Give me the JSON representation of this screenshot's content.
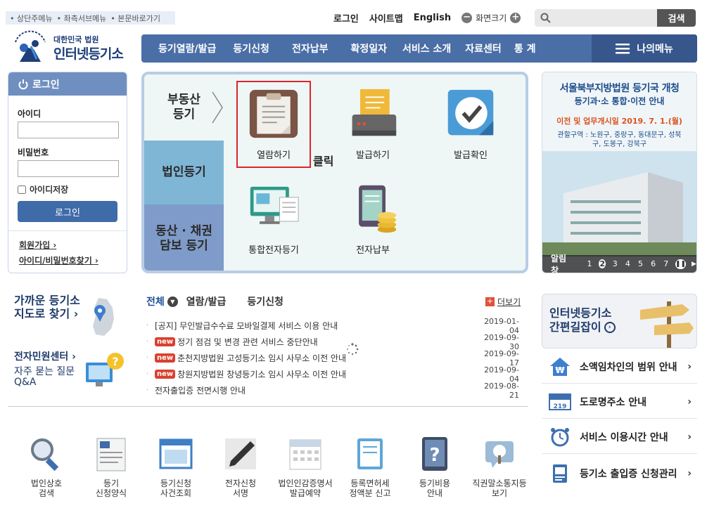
{
  "skip_links": [
    "• 상단주메뉴",
    "• 좌측서브메뉴",
    "• 본문바로가기"
  ],
  "top_links": {
    "login": "로그인",
    "sitemap": "사이트맵",
    "english": "English",
    "zoom_label": "화면크기",
    "zoom_out": "−",
    "zoom_in": "+"
  },
  "search": {
    "placeholder": "",
    "button": "검색"
  },
  "logo": {
    "subtitle": "대한민국 법원",
    "title": "인터넷등기소"
  },
  "gnb": [
    "등기열람/발급",
    "등기신청",
    "전자납부",
    "확정일자",
    "서비스 소개",
    "자료센터",
    "통 계"
  ],
  "my_menu": "나의메뉴",
  "login_box": {
    "header": "로그인",
    "id_label": "아이디",
    "pw_label": "비밀번호",
    "save_id": "아이디저장",
    "login_button": "로그인",
    "join": "회원가입 ›",
    "find": "아이디/비밀번호찾기 ›"
  },
  "tabs": {
    "real_estate": "부동산\n등기",
    "corporate": "법인등기",
    "movable": "동산 · 채권\n담보 등기"
  },
  "services": [
    {
      "label": "열람하기",
      "icon": "clipboard-icon"
    },
    {
      "label": "발급하기",
      "icon": "printer-icon"
    },
    {
      "label": "발급확인",
      "icon": "check-icon"
    },
    {
      "label": "통합전자등기",
      "icon": "monitor-document-icon"
    },
    {
      "label": "전자납부",
      "icon": "tablet-coins-icon"
    }
  ],
  "click_label": "클릭",
  "banner": {
    "line1": "서울북부지방법원 등기국 개청",
    "line2": "등기과·소 통합·이전 안내",
    "line3": "이전 및 업무개시일  2019. 7. 1.(월)",
    "line4": "관할구역 : 노원구, 중랑구, 동대문구, 성북구, 도봉구, 강북구",
    "alert_label": "알림창",
    "pages": [
      "1",
      "2",
      "3",
      "4",
      "5",
      "6",
      "7"
    ],
    "current_page": "2"
  },
  "quick": {
    "nearby": "가까운 등기소",
    "map": "지도로 찾기 ›",
    "center": "전자민원센터 ›",
    "faq1": "자주 묻는 질문",
    "faq2": "Q&A"
  },
  "news_tabs": [
    "전체",
    "열람/발급",
    "등기신청"
  ],
  "more": "더보기",
  "news": [
    {
      "badge": "",
      "title": "[공지] 무인발급수수료 모바일결제 서비스 이용 안내",
      "date": "2019-01-04"
    },
    {
      "badge": "new",
      "title": "정기 점검 및 변경 관련 서비스 중단안내",
      "date": "2019-09-30"
    },
    {
      "badge": "new",
      "title": "춘천지방법원 고성등기소 임시 사무소 이전 안내",
      "date": "2019-09-17"
    },
    {
      "badge": "new",
      "title": "창원지방법원 창녕등기소 임시 사무소 이전 안내",
      "date": "2019-09-04"
    },
    {
      "badge": "",
      "title": "전자출입증 전면시행 안내",
      "date": "2019-08-21"
    }
  ],
  "bottom_items": [
    {
      "l1": "법인상호",
      "l2": "검색",
      "icon": "magnifier-icon"
    },
    {
      "l1": "등기",
      "l2": "신청양식",
      "icon": "form-icon"
    },
    {
      "l1": "등기신청",
      "l2": "사건조회",
      "icon": "window-icon"
    },
    {
      "l1": "전자신청",
      "l2": "서명",
      "icon": "pen-icon"
    },
    {
      "l1": "법인인감증명서",
      "l2": "발급예약",
      "icon": "calendar-icon"
    },
    {
      "l1": "등록면허세",
      "l2": "정액분 신고",
      "icon": "book-icon"
    },
    {
      "l1": "등기비용",
      "l2": "안내",
      "icon": "question-icon"
    },
    {
      "l1": "직권말소통지등",
      "l2": "보기",
      "icon": "tree-icon"
    }
  ],
  "guide": {
    "l1": "인터넷등기소",
    "l2": "간편길잡이"
  },
  "right_links": [
    {
      "label": "소액임차인의 범위 안내",
      "icon": "house-won-icon"
    },
    {
      "label": "도로명주소 안내",
      "icon": "address-sign-icon"
    },
    {
      "label": "서비스 이용시간 안내",
      "icon": "alarm-clock-icon"
    },
    {
      "label": "등기소 출입증 신청관리",
      "icon": "pass-card-icon"
    }
  ],
  "colors": {
    "primary": "#4a6ea6",
    "highlight": "#e1232b",
    "badge": "#d9412d"
  }
}
